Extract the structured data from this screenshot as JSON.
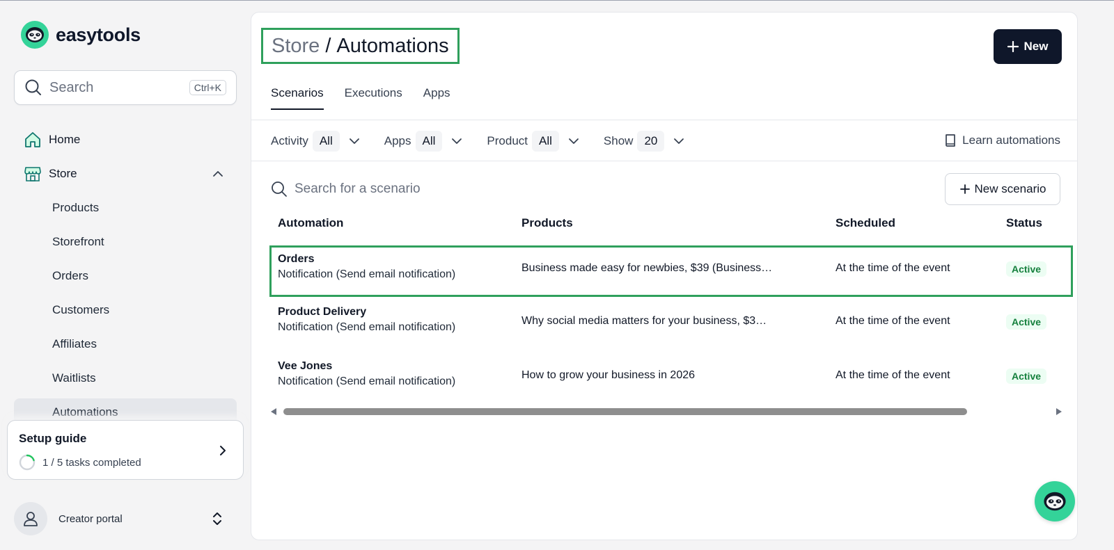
{
  "brand": {
    "name": "easytools",
    "accent": "#34d399"
  },
  "sidebar": {
    "search_label": "Search",
    "search_shortcut": "Ctrl+K",
    "home_label": "Home",
    "store_label": "Store",
    "store_items": [
      "Products",
      "Storefront",
      "Orders",
      "Customers",
      "Affiliates",
      "Waitlists",
      "Automations"
    ],
    "setup_guide": {
      "title": "Setup guide",
      "progress_text": "1 / 5 tasks completed",
      "completed": 1,
      "total": 5
    },
    "creator_label": "Creator portal"
  },
  "header": {
    "breadcrumb_parent": "Store",
    "breadcrumb_separator": "/",
    "breadcrumb_current": "Automations",
    "new_button": "New"
  },
  "tabs": [
    "Scenarios",
    "Executions",
    "Apps"
  ],
  "filters": [
    {
      "label": "Activity",
      "value": "All"
    },
    {
      "label": "Apps",
      "value": "All"
    },
    {
      "label": "Product",
      "value": "All"
    },
    {
      "label": "Show",
      "value": "20"
    }
  ],
  "learn_link": "Learn automations",
  "scenario_search_placeholder": "Search for a scenario",
  "new_scenario_button": "New scenario",
  "table": {
    "columns": [
      "Automation",
      "Products",
      "Scheduled",
      "Status"
    ],
    "rows": [
      {
        "name": "Orders",
        "type": "Notification (Send email notification)",
        "products": "Business made easy for newbies, $39 (Business…",
        "scheduled": "At the time of the event",
        "status": "Active"
      },
      {
        "name": "Product Delivery",
        "type": "Notification (Send email notification)",
        "products": "Why social media matters for your business, $3…",
        "scheduled": "At the time of the event",
        "status": "Active"
      },
      {
        "name": "Vee Jones",
        "type": "Notification (Send email notification)",
        "products": "How to grow your business in 2026",
        "scheduled": "At the time of the event",
        "status": "Active"
      }
    ]
  },
  "icons": {
    "logo": "sloth-logo-icon",
    "search": "search-icon",
    "home": "home-icon",
    "store": "store-icon",
    "book": "book-icon",
    "chat": "sloth-chat-icon"
  }
}
